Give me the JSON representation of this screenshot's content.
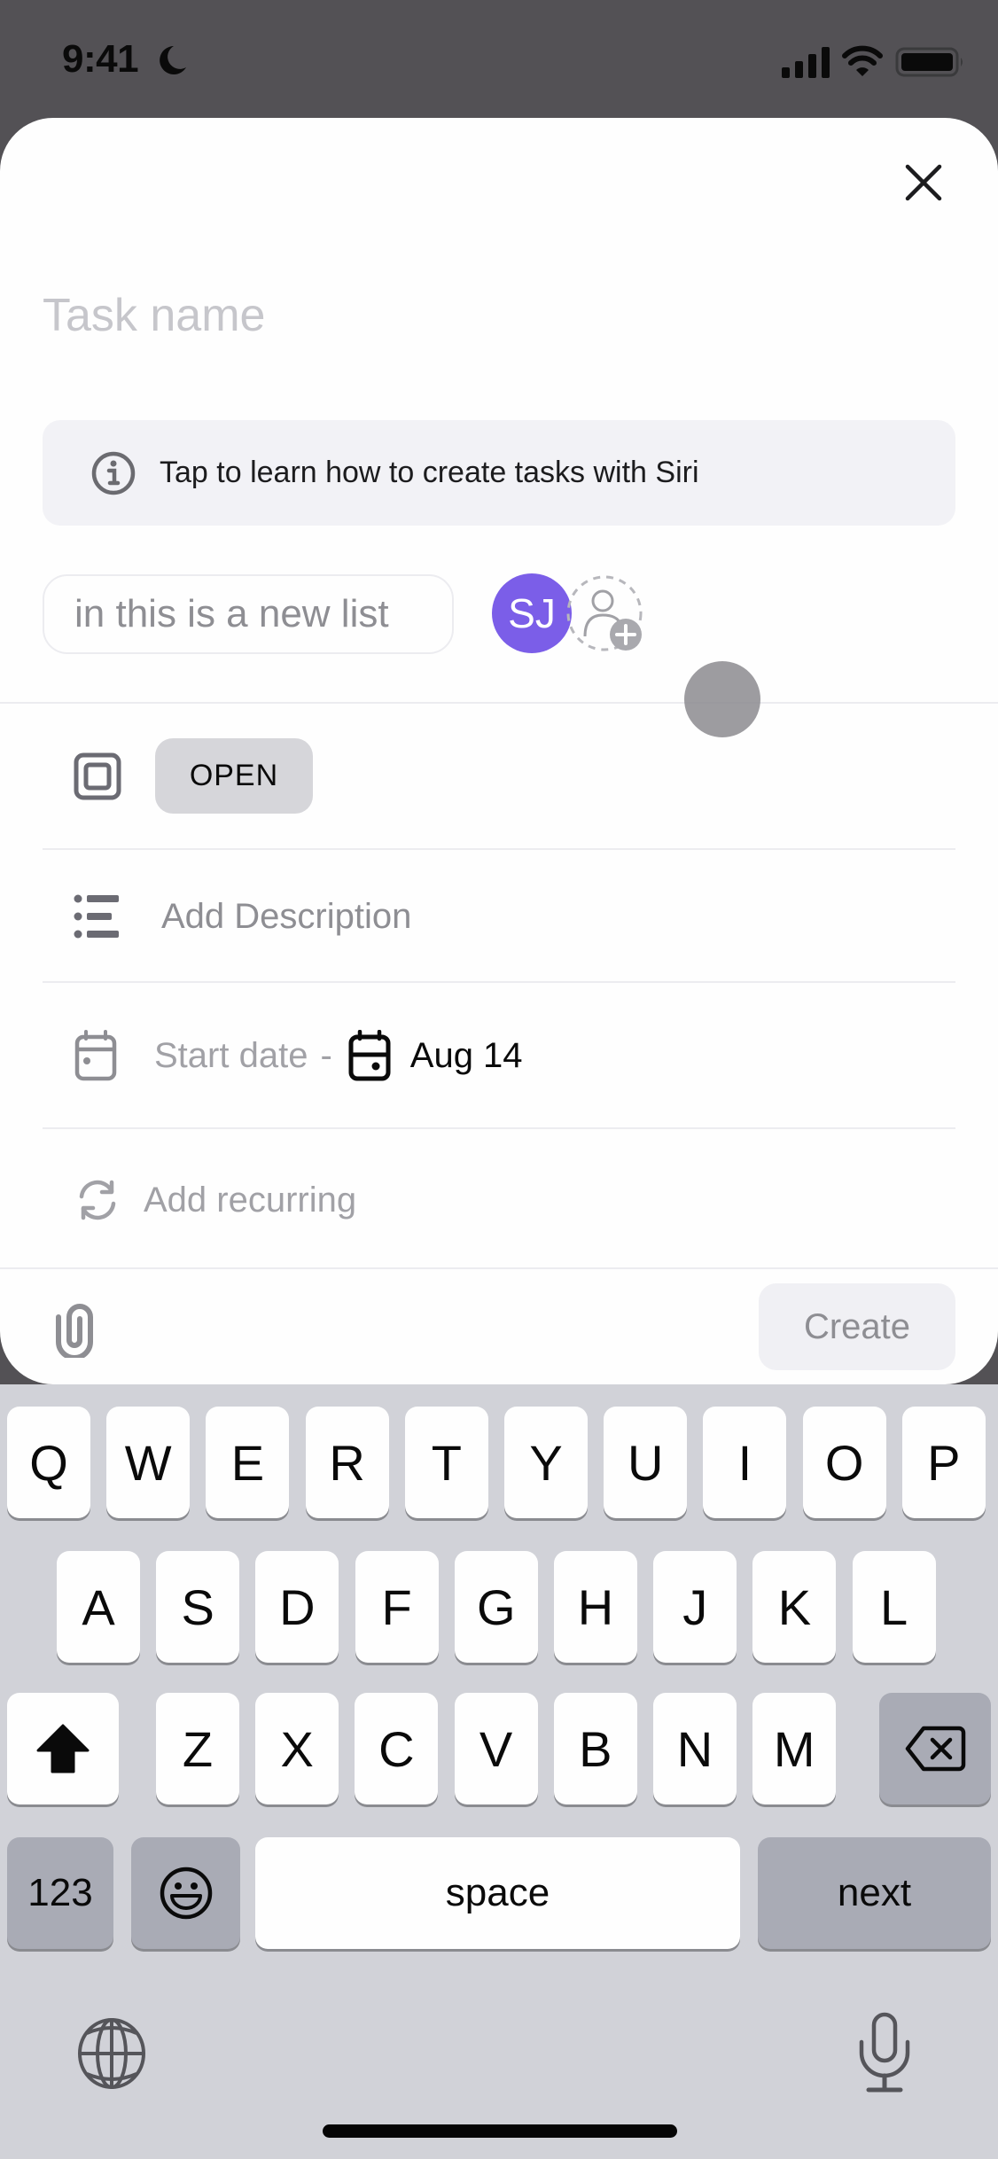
{
  "status_bar": {
    "time": "9:41",
    "focus_icon": "moon-icon",
    "signal_icon": "cellular-signal-icon",
    "wifi_icon": "wifi-icon",
    "battery_icon": "battery-icon"
  },
  "sheet": {
    "close_icon": "close-icon",
    "task_name": {
      "value": "",
      "placeholder": "Task name"
    },
    "siri_hint": {
      "icon": "info-icon",
      "text": "Tap to learn how to create tasks with Siri"
    },
    "list_selector": "in this is a new list",
    "assignee": {
      "initials": "SJ",
      "color": "#7b5ee8"
    },
    "add_assignee_icon": "add-user-icon",
    "status": {
      "icon": "status-square-icon",
      "label": "OPEN"
    },
    "description": {
      "icon": "list-icon",
      "placeholder": "Add Description"
    },
    "dates": {
      "icon": "calendar-icon",
      "start_label": "Start date",
      "separator": "-",
      "due_icon": "calendar-icon",
      "due_value": "Aug 14"
    },
    "recurring": {
      "icon": "recurring-icon",
      "label": "Add recurring"
    },
    "footer": {
      "attach_icon": "paperclip-icon",
      "create_label": "Create"
    }
  },
  "keyboard": {
    "row1": [
      "Q",
      "W",
      "E",
      "R",
      "T",
      "Y",
      "U",
      "I",
      "O",
      "P"
    ],
    "row2": [
      "A",
      "S",
      "D",
      "F",
      "G",
      "H",
      "J",
      "K",
      "L"
    ],
    "row3": [
      "Z",
      "X",
      "C",
      "V",
      "B",
      "N",
      "M"
    ],
    "shift_icon": "shift-icon",
    "delete_icon": "delete-backspace-icon",
    "numbers_label": "123",
    "emoji_icon": "emoji-icon",
    "space_label": "space",
    "return_label": "next",
    "globe_icon": "globe-icon",
    "mic_icon": "microphone-icon"
  },
  "colors": {
    "backdrop": "#535155",
    "accent_avatar": "#7b5ee8",
    "keyboard_bg": "#d1d2d8",
    "status_pill": "#d6d6da"
  }
}
